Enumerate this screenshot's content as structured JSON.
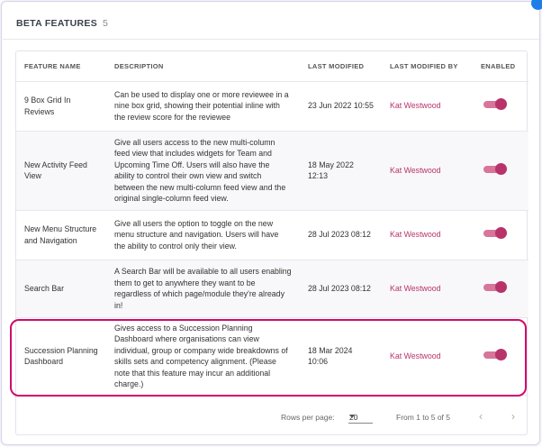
{
  "header": {
    "title": "BETA FEATURES",
    "count": "5"
  },
  "table": {
    "columns": [
      "FEATURE NAME",
      "DESCRIPTION",
      "LAST MODIFIED",
      "LAST MODIFIED BY",
      "ENABLED"
    ],
    "rows": [
      {
        "name": "9 Box Grid In Reviews",
        "description": "Can be used to display one or more reviewee in a nine box grid, showing their potential inline with the review score for the reviewee",
        "modified": "23 Jun 2022 10:55",
        "modified_by": "Kat Westwood",
        "enabled": true
      },
      {
        "name": "New Activity Feed View",
        "description": "Give all users access to the new multi-column feed view that includes widgets for Team and Upcoming Time Off. Users will also have the ability to control their own view and switch between the new multi-column feed view and the original single-column feed view.",
        "modified": "18 May 2022 12:13",
        "modified_by": "Kat Westwood",
        "enabled": true
      },
      {
        "name": "New Menu Structure and Navigation",
        "description": "Give all users the option to toggle on the new menu structure and navigation. Users will have the ability to control only their view.",
        "modified": "28 Jul 2023 08:12",
        "modified_by": "Kat Westwood",
        "enabled": true
      },
      {
        "name": "Search Bar",
        "description": "A Search Bar will be available to all users enabling them to get to anywhere they want to be regardless of which page/module they're already in!",
        "modified": "28 Jul 2023 08:12",
        "modified_by": "Kat Westwood",
        "enabled": true
      },
      {
        "name": "Succession Planning Dashboard",
        "description": "Gives access to a Succession Planning Dashboard where organisations can view individual, group or company wide breakdowns of skills sets and competency alignment. (Please note that this feature may incur an additional charge.)",
        "modified": "18 Mar 2024 10:06",
        "modified_by": "Kat Westwood",
        "enabled": true
      }
    ]
  },
  "pager": {
    "rows_per_page_label": "Rows per page:",
    "rows_per_page_value": "20",
    "range": "From 1 to 5 of 5",
    "prev_icon": "chevron-left-icon",
    "next_icon": "chevron-right-icon"
  },
  "colors": {
    "accent": "#b8336a",
    "highlight": "#d10a6a",
    "corner_dot": "#1f7de8"
  }
}
